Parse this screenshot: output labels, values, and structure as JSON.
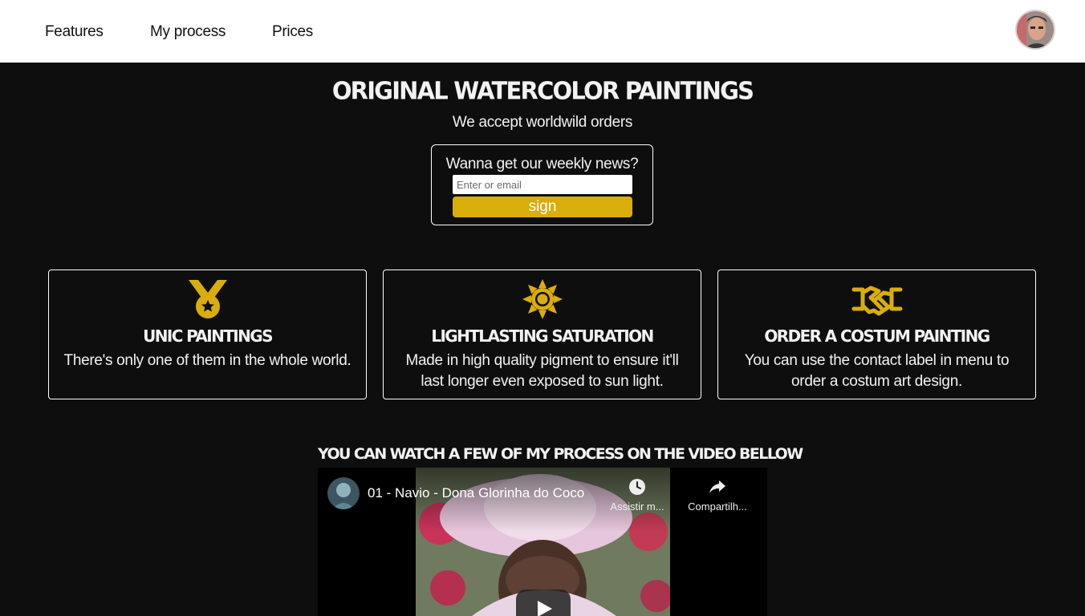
{
  "nav": {
    "items": [
      {
        "label": "Features"
      },
      {
        "label": "My process"
      },
      {
        "label": "Prices"
      }
    ]
  },
  "hero": {
    "title": "Original watercolor paintings",
    "subtitle": "We accept worldwild orders"
  },
  "newsletter": {
    "label": "Wanna get our weekly news?",
    "placeholder": "Enter or email",
    "value": "",
    "button": "sign"
  },
  "features": [
    {
      "icon": "medal-icon",
      "title": "Unic paintings",
      "text": "There's only one of them in the whole world."
    },
    {
      "icon": "sun-icon",
      "title": "Lightlasting saturation",
      "text": "Made in high quality pigment to ensure it'll last longer even exposed to sun light."
    },
    {
      "icon": "handshake-icon",
      "title": "Order a costum painting",
      "text": "You can use the contact label in menu to order a costum art design."
    }
  ],
  "video_section": {
    "title": "You can watch a few of my process on the video bellow",
    "video_name": "01 - Navio - Dona Glorinha do Coco",
    "watch_later": "Assistir m...",
    "share": "Compartilh..."
  },
  "colors": {
    "accent": "#d9ad0a",
    "background": "#0e0e0e",
    "nav_background": "#ffffff"
  }
}
